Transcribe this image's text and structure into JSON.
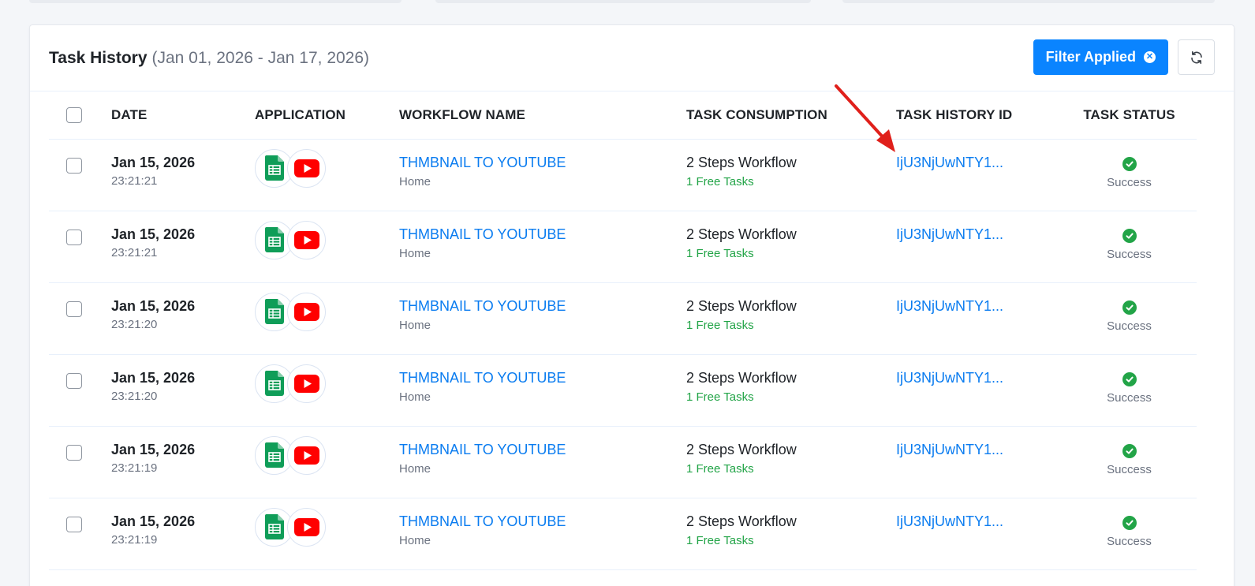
{
  "header": {
    "title": "Task History",
    "date_range": "(Jan 01, 2026 - Jan 17, 2026)",
    "filter_label": "Filter Applied"
  },
  "columns": {
    "date": "DATE",
    "application": "APPLICATION",
    "workflow_name": "WORKFLOW NAME",
    "task_consumption": "TASK CONSUMPTION",
    "task_history_id": "TASK HISTORY ID",
    "task_status": "TASK STATUS"
  },
  "rows": [
    {
      "date": "Jan 15, 2026",
      "time": "23:21:21",
      "apps": [
        "google-sheets-icon",
        "youtube-icon"
      ],
      "workflow": "THMBNAIL TO YOUTUBE",
      "folder": "Home",
      "consumption": "2 Steps Workflow",
      "free": "1 Free Tasks",
      "history_id": "IjU3NjUwNTY1...",
      "status": "Success"
    },
    {
      "date": "Jan 15, 2026",
      "time": "23:21:21",
      "apps": [
        "google-sheets-icon",
        "youtube-icon"
      ],
      "workflow": "THMBNAIL TO YOUTUBE",
      "folder": "Home",
      "consumption": "2 Steps Workflow",
      "free": "1 Free Tasks",
      "history_id": "IjU3NjUwNTY1...",
      "status": "Success"
    },
    {
      "date": "Jan 15, 2026",
      "time": "23:21:20",
      "apps": [
        "google-sheets-icon",
        "youtube-icon"
      ],
      "workflow": "THMBNAIL TO YOUTUBE",
      "folder": "Home",
      "consumption": "2 Steps Workflow",
      "free": "1 Free Tasks",
      "history_id": "IjU3NjUwNTY1...",
      "status": "Success"
    },
    {
      "date": "Jan 15, 2026",
      "time": "23:21:20",
      "apps": [
        "google-sheets-icon",
        "youtube-icon"
      ],
      "workflow": "THMBNAIL TO YOUTUBE",
      "folder": "Home",
      "consumption": "2 Steps Workflow",
      "free": "1 Free Tasks",
      "history_id": "IjU3NjUwNTY1...",
      "status": "Success"
    },
    {
      "date": "Jan 15, 2026",
      "time": "23:21:19",
      "apps": [
        "google-sheets-icon",
        "youtube-icon"
      ],
      "workflow": "THMBNAIL TO YOUTUBE",
      "folder": "Home",
      "consumption": "2 Steps Workflow",
      "free": "1 Free Tasks",
      "history_id": "IjU3NjUwNTY1...",
      "status": "Success"
    },
    {
      "date": "Jan 15, 2026",
      "time": "23:21:19",
      "apps": [
        "google-sheets-icon",
        "youtube-icon"
      ],
      "workflow": "THMBNAIL TO YOUTUBE",
      "folder": "Home",
      "consumption": "2 Steps Workflow",
      "free": "1 Free Tasks",
      "history_id": "IjU3NjUwNTY1...",
      "status": "Success"
    }
  ],
  "colors": {
    "primary": "#0a84ff",
    "link": "#0a7cf0",
    "success": "#22a447",
    "annotation_arrow": "#e0201b"
  },
  "icons": {
    "filter_clear": "close-circle-icon",
    "refresh": "refresh-icon",
    "status": "check-circle-icon",
    "annotation": "red-arrow-icon"
  }
}
